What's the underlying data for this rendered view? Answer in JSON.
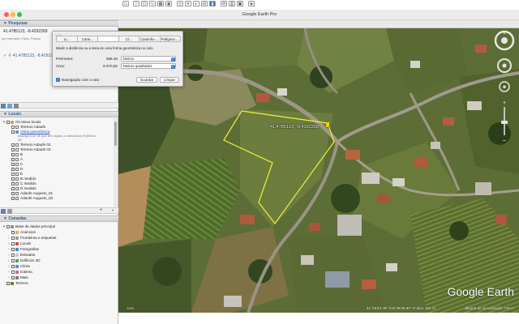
{
  "window": {
    "title": "Google Earth Pro"
  },
  "search": {
    "header": "Pesquisar",
    "query_value": "41.4785123, -8.4292289",
    "query_hint": "por exemplo, Paris, França",
    "result_label": "41.4785123, -8.4292289"
  },
  "places": {
    "header": "Locais",
    "items": [
      {
        "label": "Os Meus locais",
        "type": "folder"
      },
      {
        "label": "Terreno Adaufe",
        "type": "place"
      },
      {
        "label": "Visita panorâmica",
        "type": "link"
      },
      {
        "label": "Assegure-se de que tem ligada a camada de Edifícios 3D",
        "type": "desc"
      },
      {
        "label": "Terreno Adaufe 02",
        "type": "place"
      },
      {
        "label": "Terreno Adaufe 03",
        "type": "place"
      },
      {
        "label": "B",
        "type": "place"
      },
      {
        "label": "A",
        "type": "place"
      },
      {
        "label": "C",
        "type": "place"
      },
      {
        "label": "D",
        "type": "place"
      },
      {
        "label": "E",
        "type": "place"
      },
      {
        "label": "B medido",
        "type": "place"
      },
      {
        "label": "C medido",
        "type": "place"
      },
      {
        "label": "D medido",
        "type": "place"
      },
      {
        "label": "Adaufe Augusto_01",
        "type": "place"
      },
      {
        "label": "Adaufe Augusto_03",
        "type": "place"
      }
    ]
  },
  "layers": {
    "header": "Camadas",
    "items": [
      {
        "label": "Base de dados principal"
      },
      {
        "label": "Anúncios"
      },
      {
        "label": "Fronteiras e etiquetas"
      },
      {
        "label": "Locais"
      },
      {
        "label": "Fotografias"
      },
      {
        "label": "Estradas"
      },
      {
        "label": "Edifícios 3D"
      },
      {
        "label": "Clima"
      },
      {
        "label": "Galeria"
      },
      {
        "label": "Mais"
      },
      {
        "label": "Terreno"
      }
    ]
  },
  "measure_dialog": {
    "tabs": [
      "Li...",
      "Cami...",
      "Cí...",
      "Caminho ...",
      "Polígono ..."
    ],
    "selected_tab": 2,
    "description": "Medir a distância ou a área de uma forma geométrica no solo",
    "perimeter_label": "Perímetro:",
    "perimeter_value": "568.46",
    "perimeter_unit": "Metros",
    "area_label": "Área:",
    "area_value": "8 670,52",
    "area_unit": "Metros quadrados",
    "nav_checkbox_label": "Navegação com o rato",
    "save_label": "Guardar",
    "clear_label": "Limpar"
  },
  "map": {
    "marker_label": "41.4785123, -8.4292289",
    "logo": "Google Earth",
    "status_left": "1993",
    "status_coords": "41°28'43.49\" N   8°25'38.60\" O   elev. 221 m",
    "status_altitude": "altitude de visualização   746 m",
    "polygon_color": "#f2f23a"
  }
}
